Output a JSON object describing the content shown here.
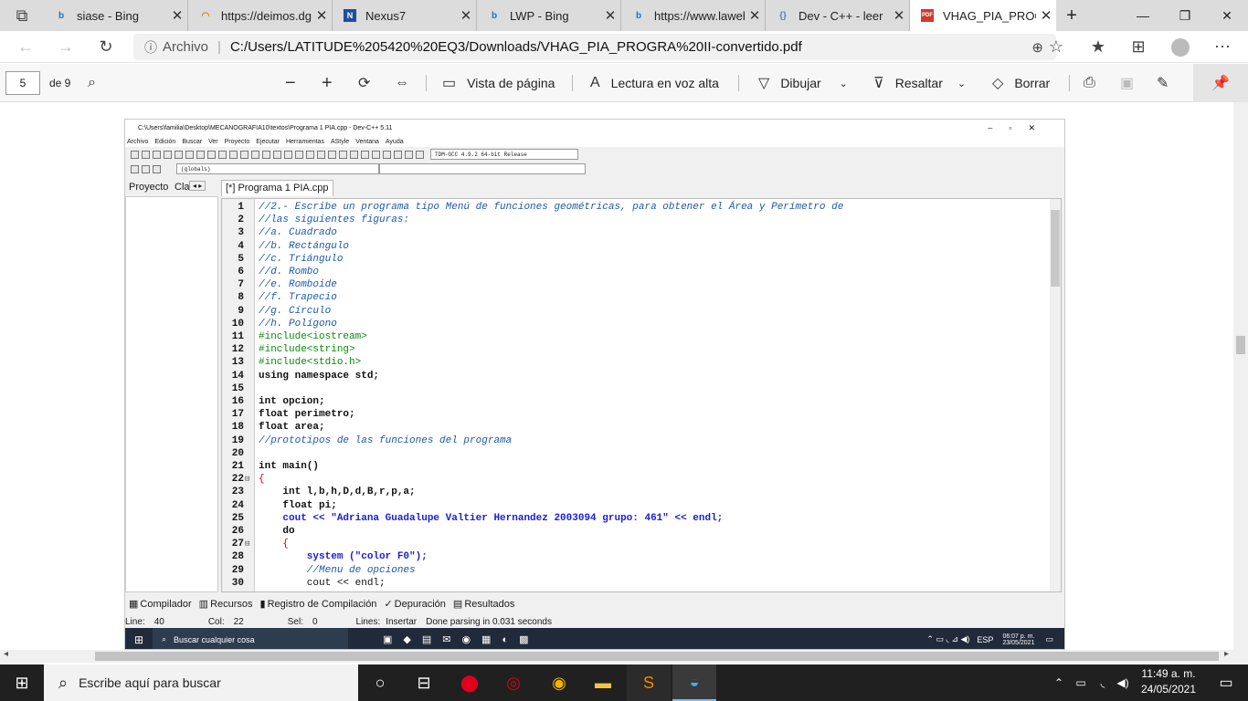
{
  "tabs": [
    {
      "title": "siase - Bing",
      "icon": "bing-icon"
    },
    {
      "title": "https://deimos.dgi.uanl.mx",
      "icon": "reload-spinner-icon"
    },
    {
      "title": "Nexus7",
      "icon": "nexus-icon"
    },
    {
      "title": "LWP - Bing",
      "icon": "bing-icon"
    },
    {
      "title": "https://www.lawebdelprogramador.com",
      "icon": "bing-icon"
    },
    {
      "title": "Dev - C++ - leer",
      "icon": "code-icon"
    },
    {
      "title": "VHAG_PIA_PROGRA II",
      "icon": "pdf-icon",
      "active": true
    }
  ],
  "address": {
    "scheme": "Archivo",
    "url": "C:/Users/LATITUDE%205420%20EQ3/Downloads/VHAG_PIA_PROGRA%20II-convertido.pdf"
  },
  "pdf_toolbar": {
    "page": "5",
    "of_pages": "de 9",
    "page_view": "Vista de página",
    "read_aloud": "Lectura en voz alta",
    "draw": "Dibujar",
    "highlight": "Resaltar",
    "erase": "Borrar"
  },
  "devcpp": {
    "title": "C:\\Users\\familia\\Desktop\\MECANOGRAFIA10\\textos\\Programa 1 PIA.cpp - Dev-C++ 5.11",
    "menu": [
      "Archivo",
      "Edición",
      "Buscar",
      "Ver",
      "Proyecto",
      "Ejecutar",
      "Herramientas",
      "AStyle",
      "Ventana",
      "Ayuda"
    ],
    "compiler": "TDM-GCC 4.9.2 64-bit Release",
    "globals": "(globals)",
    "left_tabs": [
      "Proyecto",
      "Cla"
    ],
    "file_tab": "[*] Programa 1 PIA.cpp",
    "bottom_tabs": [
      "Compilador",
      "Recursos",
      "Registro de Compilación",
      "Depuración",
      "Resultados"
    ],
    "status": {
      "line_label": "Line:",
      "line": "40",
      "col_label": "Col:",
      "col": "22",
      "sel_label": "Sel:",
      "sel": "0",
      "lines_label": "Lines:",
      "mode": "Insertar",
      "message": "Done parsing in 0.031 seconds"
    },
    "inner_taskbar": {
      "search": "Buscar cualquier cosa",
      "lang": "ESP",
      "time": "06:07 p. m.",
      "date": "23/05/2021"
    }
  },
  "code_lines": [
    {
      "n": "1",
      "t": "//2.- Escribe un programa tipo Menú de funciones geométricas, para obtener el Área y Perímetro de",
      "c": "cm"
    },
    {
      "n": "2",
      "t": "//las siguientes figuras:",
      "c": "cm"
    },
    {
      "n": "3",
      "t": "//a. Cuadrado",
      "c": "cm"
    },
    {
      "n": "4",
      "t": "//b. Rectángulo",
      "c": "cm"
    },
    {
      "n": "5",
      "t": "//c. Triángulo",
      "c": "cm"
    },
    {
      "n": "6",
      "t": "//d. Rombo",
      "c": "cm"
    },
    {
      "n": "7",
      "t": "//e. Romboide",
      "c": "cm"
    },
    {
      "n": "8",
      "t": "//f. Trapecio",
      "c": "cm"
    },
    {
      "n": "9",
      "t": "//g. Círculo",
      "c": "cm"
    },
    {
      "n": "10",
      "t": "//h. Polígono",
      "c": "cm"
    },
    {
      "n": "11",
      "t": "#include<iostream>",
      "c": "pp"
    },
    {
      "n": "12",
      "t": "#include<string>",
      "c": "pp"
    },
    {
      "n": "13",
      "t": "#include<stdio.h>",
      "c": "pp"
    },
    {
      "n": "14",
      "t": "using namespace std;",
      "c": "kw"
    },
    {
      "n": "15",
      "t": "",
      "c": ""
    },
    {
      "n": "16",
      "t": "int opcion;",
      "c": "kw"
    },
    {
      "n": "17",
      "t": "float perimetro;",
      "c": "kw"
    },
    {
      "n": "18",
      "t": "float area;",
      "c": "kw"
    },
    {
      "n": "19",
      "t": "//prototipos de las funciones del programa",
      "c": "cm"
    },
    {
      "n": "20",
      "t": "",
      "c": ""
    },
    {
      "n": "21",
      "t": "int main()",
      "c": "kw"
    },
    {
      "n": "22",
      "t": "{",
      "c": "sy",
      "fold": true
    },
    {
      "n": "23",
      "t": "    int l,b,h,D,d,B,r,p,a;",
      "c": "kw"
    },
    {
      "n": "24",
      "t": "    float pi;",
      "c": "kw"
    },
    {
      "n": "25",
      "t": "    cout << \"Adriana Guadalupe Valtier Hernandez 2003094 grupo: 461\" << endl;",
      "c": "st"
    },
    {
      "n": "26",
      "t": "    do",
      "c": "kw"
    },
    {
      "n": "27",
      "t": "    {",
      "c": "sy",
      "fold": true
    },
    {
      "n": "28",
      "t": "        system (\"color F0\");",
      "c": "st"
    },
    {
      "n": "29",
      "t": "        //Menu de opciones",
      "c": "cm"
    },
    {
      "n": "30",
      "t": "        cout << endl;",
      "c": ""
    }
  ],
  "taskbar": {
    "search": "Escribe aquí para buscar",
    "time": "11:49 a. m.",
    "date": "24/05/2021"
  }
}
